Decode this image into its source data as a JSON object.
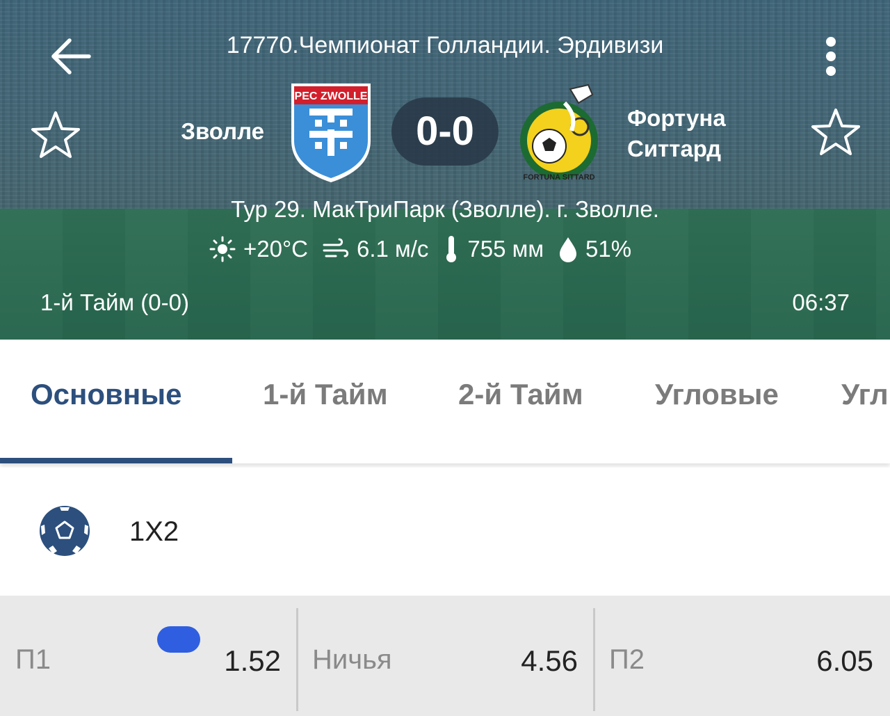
{
  "header": {
    "league": "17770.Чемпионат Голландии. Эрдивизи",
    "team_home": "Зволле",
    "team_away_line1": "Фортуна",
    "team_away_line2": "Ситтард",
    "score": "0-0",
    "venue": "Тур 29. МакТриПарк (Зволле). г. Зволле.",
    "weather": {
      "temperature": "+20°C",
      "wind": "6.1 м/с",
      "pressure": "755 мм",
      "humidity": "51%"
    },
    "period": "1-й  Тайм (0-0)",
    "clock": "06:37",
    "crest_home_text": "PEC ZWOLLE",
    "crest_away_text": "FORTUNA SITTARD",
    "icons": [
      "back-arrow-icon",
      "more-vertical-icon",
      "star-icon",
      "sun-icon",
      "wind-icon",
      "thermometer-icon",
      "drop-icon"
    ]
  },
  "tabs": [
    {
      "label": "Основные",
      "active": true
    },
    {
      "label": "1-й  Тайм",
      "active": false
    },
    {
      "label": "2-й  Тайм",
      "active": false
    },
    {
      "label": "Угловые",
      "active": false
    },
    {
      "label": "Угл",
      "active": false
    }
  ],
  "market": {
    "title": "1X2",
    "icon": "soccer-ball-icon"
  },
  "odds": [
    {
      "label": "П1",
      "value": "1.52"
    },
    {
      "label": "Ничья",
      "value": "4.56"
    },
    {
      "label": "П2",
      "value": "6.05"
    }
  ],
  "colors": {
    "accent": "#2c4f7d",
    "pill": "#2f5fe0",
    "odds_bg": "#e9e9e9"
  }
}
